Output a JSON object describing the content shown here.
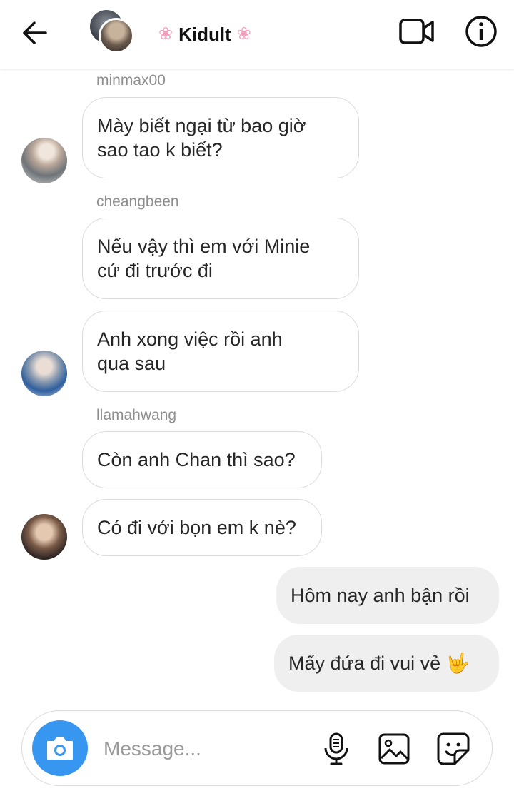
{
  "header": {
    "title": "Kidult",
    "decoration_glyph": "❀",
    "icons": [
      "back-arrow-icon",
      "video-camera-icon",
      "info-icon"
    ]
  },
  "messages": [
    {
      "sender": "minmax00",
      "lines": [
        "Mày biết ngại từ bao giờ",
        "sao tao k biết?"
      ]
    },
    {
      "sender": "cheangbeen",
      "lines": [
        "Nếu vậy thì em với Minie",
        "cứ đi trước đi"
      ]
    },
    {
      "sender": "",
      "lines": [
        "Anh xong việc rồi anh",
        "qua sau"
      ]
    },
    {
      "sender": "llamahwang",
      "lines": [
        "Còn anh Chan thì sao?"
      ]
    },
    {
      "sender": "",
      "lines": [
        "Có đi với bọn em k nè?"
      ]
    },
    {
      "sender": "me",
      "lines": [
        "Hôm nay anh bận rồi"
      ]
    },
    {
      "sender": "me",
      "lines": [
        "Mấy đứa đi vui vẻ 🤟"
      ]
    }
  ],
  "composer": {
    "placeholder": "Message...",
    "icons": [
      "camera-icon",
      "microphone-icon",
      "gallery-icon",
      "sticker-icon"
    ]
  },
  "colors": {
    "accent": "#3797f0",
    "bubble_mine": "#efefef",
    "bubble_border": "#dbdbdb",
    "sender_text": "#8e8e8e"
  }
}
